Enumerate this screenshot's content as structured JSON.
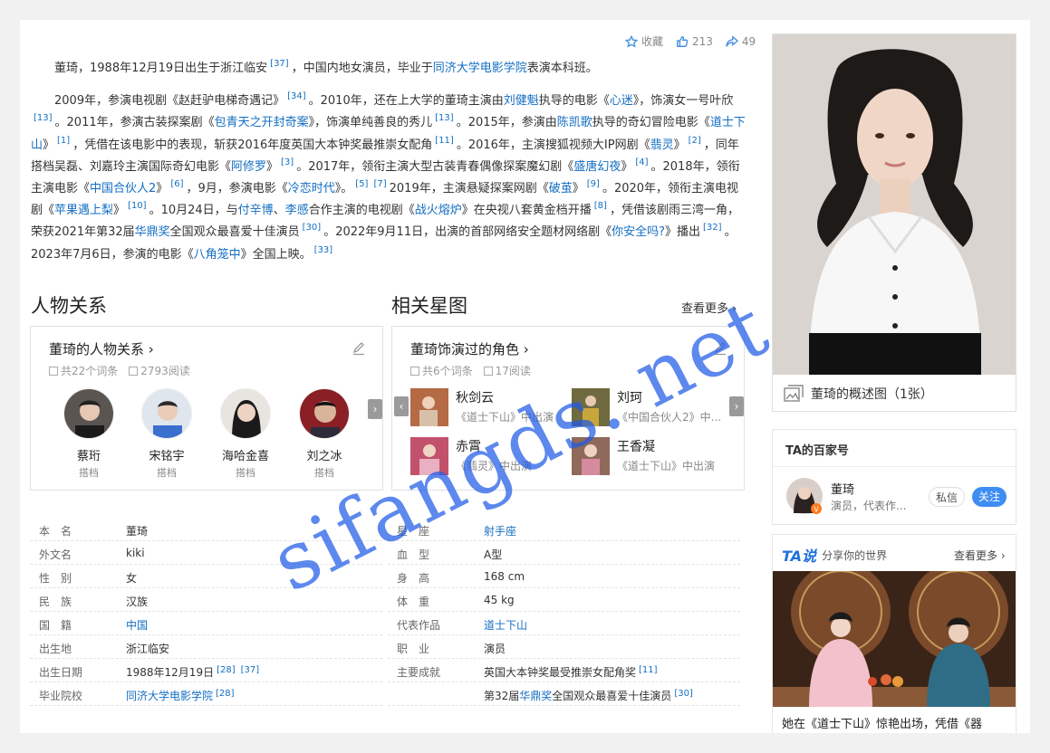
{
  "actions": {
    "favorite": "收藏",
    "likes": "213",
    "shares": "49"
  },
  "summary": {
    "p1": [
      {
        "t": "董琦，1988年12月19日出生于浙江临安"
      },
      {
        "ref": "[37]"
      },
      {
        "t": "，中国内地女演员，毕业于"
      },
      {
        "link": "同济大学电影学院"
      },
      {
        "t": "表演本科班。"
      }
    ],
    "p2": [
      {
        "t": "2009年，参演电视剧《赵赶驴电梯奇遇记》"
      },
      {
        "ref": "[34]"
      },
      {
        "t": "。2010年，还在上大学的董琦主演由"
      },
      {
        "link": "刘健魁"
      },
      {
        "t": "执导的电影《"
      },
      {
        "link": "心迷"
      },
      {
        "t": "》，饰演女一号叶欣"
      },
      {
        "ref": "[13]"
      },
      {
        "t": "。2011年，参演古装探案剧《"
      },
      {
        "link": "包青天之开封奇案"
      },
      {
        "t": "》，饰演单纯善良的秀儿"
      },
      {
        "ref": "[13]"
      },
      {
        "t": "。2015年，参演由"
      },
      {
        "link": "陈凯歌"
      },
      {
        "t": "执导的奇幻冒险电影《"
      },
      {
        "link": "道士下山"
      },
      {
        "t": "》"
      },
      {
        "ref": "[1]"
      },
      {
        "t": "，凭借在该电影中的表现，斩获2016年度英国大本钟奖最推崇女配角"
      },
      {
        "ref": "[11]"
      },
      {
        "t": "。2016年，主演搜狐视频大IP网剧《"
      },
      {
        "link": "翡灵"
      },
      {
        "t": "》"
      },
      {
        "ref": "[2]"
      },
      {
        "t": "，同年搭档吴磊、刘嘉玲主演国际奇幻电影《"
      },
      {
        "link": "阿修罗"
      },
      {
        "t": "》"
      },
      {
        "ref": "[3]"
      },
      {
        "t": "。2017年，领衔主演大型古装青春偶像探案魔幻剧《"
      },
      {
        "link": "盛唐幻夜"
      },
      {
        "t": "》"
      },
      {
        "ref": "[4]"
      },
      {
        "t": "。2018年，领衔主演电影《"
      },
      {
        "link": "中国合伙人2"
      },
      {
        "t": "》"
      },
      {
        "ref": "[6]"
      },
      {
        "t": "，9月，参演电影《"
      },
      {
        "link": "冷恋时代"
      },
      {
        "t": "》。"
      },
      {
        "ref": "[5]"
      },
      {
        "ref": "[7]"
      },
      {
        "t": "2019年，主演悬疑探案网剧《"
      },
      {
        "link": "破茧"
      },
      {
        "t": "》"
      },
      {
        "ref": "[9]"
      },
      {
        "t": "。2020年，领衔主演电视剧《"
      },
      {
        "link": "苹果遇上梨"
      },
      {
        "t": "》"
      },
      {
        "ref": "[10]"
      },
      {
        "t": "。10月24日，与"
      },
      {
        "link": "付辛博"
      },
      {
        "t": "、"
      },
      {
        "link": "李感"
      },
      {
        "t": "合作主演的电视剧《"
      },
      {
        "link": "战火熔炉"
      },
      {
        "t": "》在央视八套黄金档开播"
      },
      {
        "ref": "[8]"
      },
      {
        "t": "，凭借该剧雨三湾一角，荣获2021年第32届"
      },
      {
        "link": "华鼎奖"
      },
      {
        "t": "全国观众最喜爱十佳演员"
      },
      {
        "ref": "[30]"
      },
      {
        "t": "。2022年9月11日，出演的首部网络安全题材网络剧《"
      },
      {
        "link": "你安全吗?"
      },
      {
        "t": "》播出"
      },
      {
        "ref": "[32]"
      },
      {
        "t": "。2023年7月6日，参演的电影《"
      },
      {
        "link": "八角笼中"
      },
      {
        "t": "》全国上映。"
      },
      {
        "ref": "[33]"
      }
    ]
  },
  "relations": {
    "section_title": "人物关系",
    "card_title": "董琦的人物关系",
    "entries": "共22个词条",
    "reads": "2793阅读",
    "people": [
      {
        "name": "蔡珩",
        "rel": "搭档"
      },
      {
        "name": "宋铭宇",
        "rel": "搭档"
      },
      {
        "name": "海哈金喜",
        "rel": "搭档"
      },
      {
        "name": "刘之冰",
        "rel": "搭档"
      }
    ]
  },
  "stars": {
    "section_title": "相关星图",
    "see_more": "查看更多",
    "card_title": "董琦饰演过的角色",
    "entries": "共6个词条",
    "reads": "17阅读",
    "roles": [
      {
        "name": "秋剑云",
        "src": "《道士下山》中出演"
      },
      {
        "name": "刘珂",
        "src": "《中国合伙人2》中..."
      },
      {
        "name": "赤霄",
        "src": "《翡灵》中出演"
      },
      {
        "name": "王香凝",
        "src": "《道士下山》中出演"
      }
    ]
  },
  "basic_info": {
    "left": [
      {
        "k": "本　名",
        "v": "董琦"
      },
      {
        "k": "外文名",
        "v": "kiki"
      },
      {
        "k": "性　别",
        "v": "女"
      },
      {
        "k": "民　族",
        "v": "汉族"
      },
      {
        "k": "国　籍",
        "v": "中国",
        "link": true
      },
      {
        "k": "出生地",
        "v": "浙江临安"
      },
      {
        "k": "出生日期",
        "v": "1988年12月19日",
        "refs": [
          "[28]",
          "[37]"
        ]
      },
      {
        "k": "毕业院校",
        "v": "同济大学电影学院",
        "link": true,
        "refs": [
          "[28]"
        ]
      }
    ],
    "right": [
      {
        "k": "星　座",
        "v": "射手座",
        "link": true
      },
      {
        "k": "血　型",
        "v": "A型"
      },
      {
        "k": "身　高",
        "v": "168 cm"
      },
      {
        "k": "体　重",
        "v": "45 kg"
      },
      {
        "k": "代表作品",
        "v": "道士下山",
        "link": true
      },
      {
        "k": "职　业",
        "v": "演员"
      },
      {
        "k": "主要成就",
        "v": "英国大本钟奖最受推崇女配角奖",
        "refs": [
          "[11]"
        ]
      },
      {
        "k": "",
        "v_pre": "第32届",
        "v_link": "华鼎奖",
        "v_post": "全国观众最喜爱十佳演员",
        "refs": [
          "[30]"
        ]
      }
    ]
  },
  "photo": {
    "caption": "董琦的概述图（1张）"
  },
  "baijiahao": {
    "title": "TA的百家号",
    "name": "董琦",
    "desc": "演员，代表作...",
    "msg_btn": "私信",
    "follow_btn": "关注"
  },
  "ta_say": {
    "logo": "TA说",
    "sub": "分享你的世界",
    "more": "查看更多",
    "caption": "她在《道士下山》惊艳出场，凭借《器"
  },
  "watermark": "sifangds. net",
  "colors": {
    "link": "#136ec2",
    "follow": "#3d8df2",
    "ta_logo": "#1e6fd9"
  }
}
